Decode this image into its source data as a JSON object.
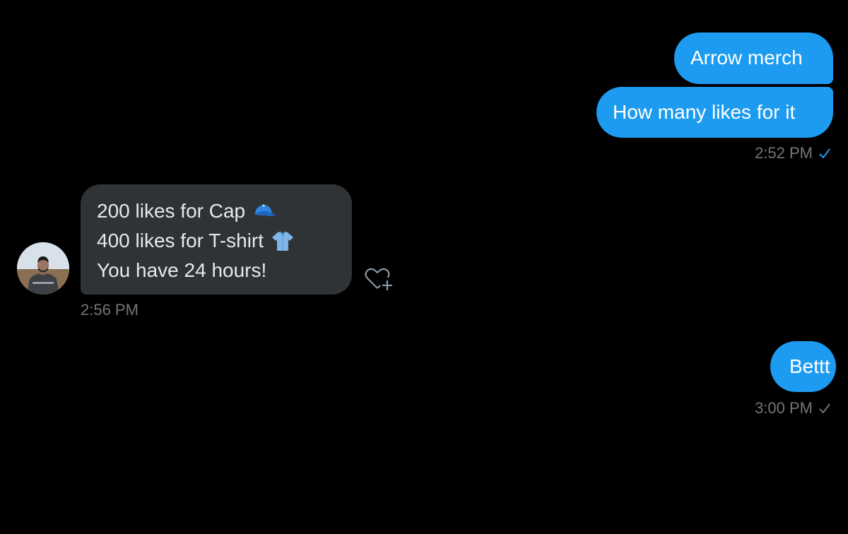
{
  "conversation": {
    "outgoing_1": {
      "text": "Arrow merch"
    },
    "outgoing_2": {
      "text": "How many likes for it",
      "time": "2:52 PM",
      "status_icon": "check-icon",
      "status_color": "#1d9bf0"
    },
    "incoming_1": {
      "lines": [
        {
          "text": "200 likes for Cap",
          "emoji": "cap-emoji"
        },
        {
          "text": "400 likes for T-shirt",
          "emoji": "shirt-emoji"
        },
        {
          "text": "You have 24 hours!"
        }
      ],
      "time": "2:56 PM",
      "avatar": "avatar",
      "reaction_icon": "heart-plus-icon"
    },
    "outgoing_3": {
      "text": "Bettt",
      "time": "3:00 PM",
      "status_icon": "check-icon",
      "status_color": "#71767b"
    }
  },
  "colors": {
    "background": "#000000",
    "outgoing_bubble": "#1d9bf0",
    "incoming_bubble": "#2f3336",
    "meta_text": "#71767b"
  }
}
